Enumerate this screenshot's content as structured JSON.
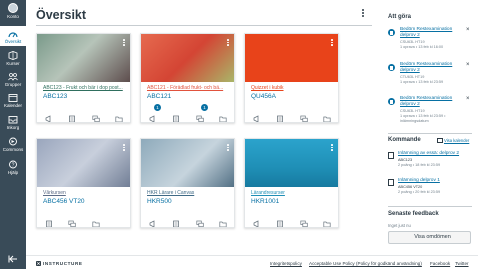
{
  "nav": {
    "items": [
      {
        "label": "Konto",
        "icon": "account-avatar"
      },
      {
        "label": "Översikt",
        "icon": "dashboard-icon",
        "active": true
      },
      {
        "label": "Kurser",
        "icon": "courses-icon"
      },
      {
        "label": "Grupper",
        "icon": "groups-icon"
      },
      {
        "label": "Kalender",
        "icon": "calendar-icon"
      },
      {
        "label": "Inkorg",
        "icon": "inbox-icon"
      },
      {
        "label": "Commons",
        "icon": "commons-icon"
      },
      {
        "label": "Hjälp",
        "icon": "help-icon"
      }
    ]
  },
  "header": {
    "title": "Översikt"
  },
  "cards": [
    {
      "name": "ABC123 - Frukt och bär i dop post...",
      "code": "ABC123",
      "color": "#2f6f5e",
      "badges": {}
    },
    {
      "name": "ABC121 - Förädlad frukt- och bä...",
      "code": "ABC121",
      "color": "#e1523d",
      "badges": {
        "announcements": "1",
        "discussions": "1"
      }
    },
    {
      "name": "Quizzet i kubik",
      "code": "QU456A",
      "color": "#e8431a",
      "badges": {}
    },
    {
      "name": "Vårkursen",
      "code": "ABC456 VT20",
      "color": "#8e9ab2",
      "badges": {}
    },
    {
      "name": "HKR Lärare i Canvas",
      "code": "HKR500",
      "color": "#6d8fa6",
      "badges": {}
    },
    {
      "name": "Lärandresurser",
      "code": "HKR1001",
      "color": "#1f8fb6",
      "badges": {}
    }
  ],
  "todo": {
    "title": "Att göra",
    "items": [
      {
        "title": "Bedöm Restexamination delprov 2",
        "course": "CSU63L HT19",
        "meta": "1 oprava • 13 feb kl 16:00"
      },
      {
        "title": "Bedöm Restexamination delprov 2",
        "course": "CTU63L HT19",
        "meta": "1 oprava • 13 feb kl 23:59",
        "badge": "4"
      },
      {
        "title": "Bedöm Restexamination delprov 2",
        "course": "CSU63L HT19",
        "meta": "1 oprava • 13 feb kl 23:59 • inlämningsdatum"
      }
    ]
  },
  "upcoming": {
    "title": "Kommande",
    "calendar_link": "Visa kalender",
    "items": [
      {
        "title": "Inlämning av essä: delprov 2",
        "course": "ABC123",
        "meta": "2 poäng • 18 feb kl 23:59"
      },
      {
        "title": "Inlämning delprov 1",
        "course": "ABC456 VT20",
        "meta": "2 poäng • 20 feb kl 23:59"
      }
    ]
  },
  "feedback": {
    "title": "Senaste feedback",
    "empty": "Inget just nu",
    "grades_button": "Visa omdömen"
  },
  "footer": {
    "logo": "INSTRUCTURE",
    "links": [
      "Integritetspolicy",
      "Acceptable Use Policy (Policy för godkänd användning)",
      "Facebook",
      "Twitter"
    ]
  }
}
